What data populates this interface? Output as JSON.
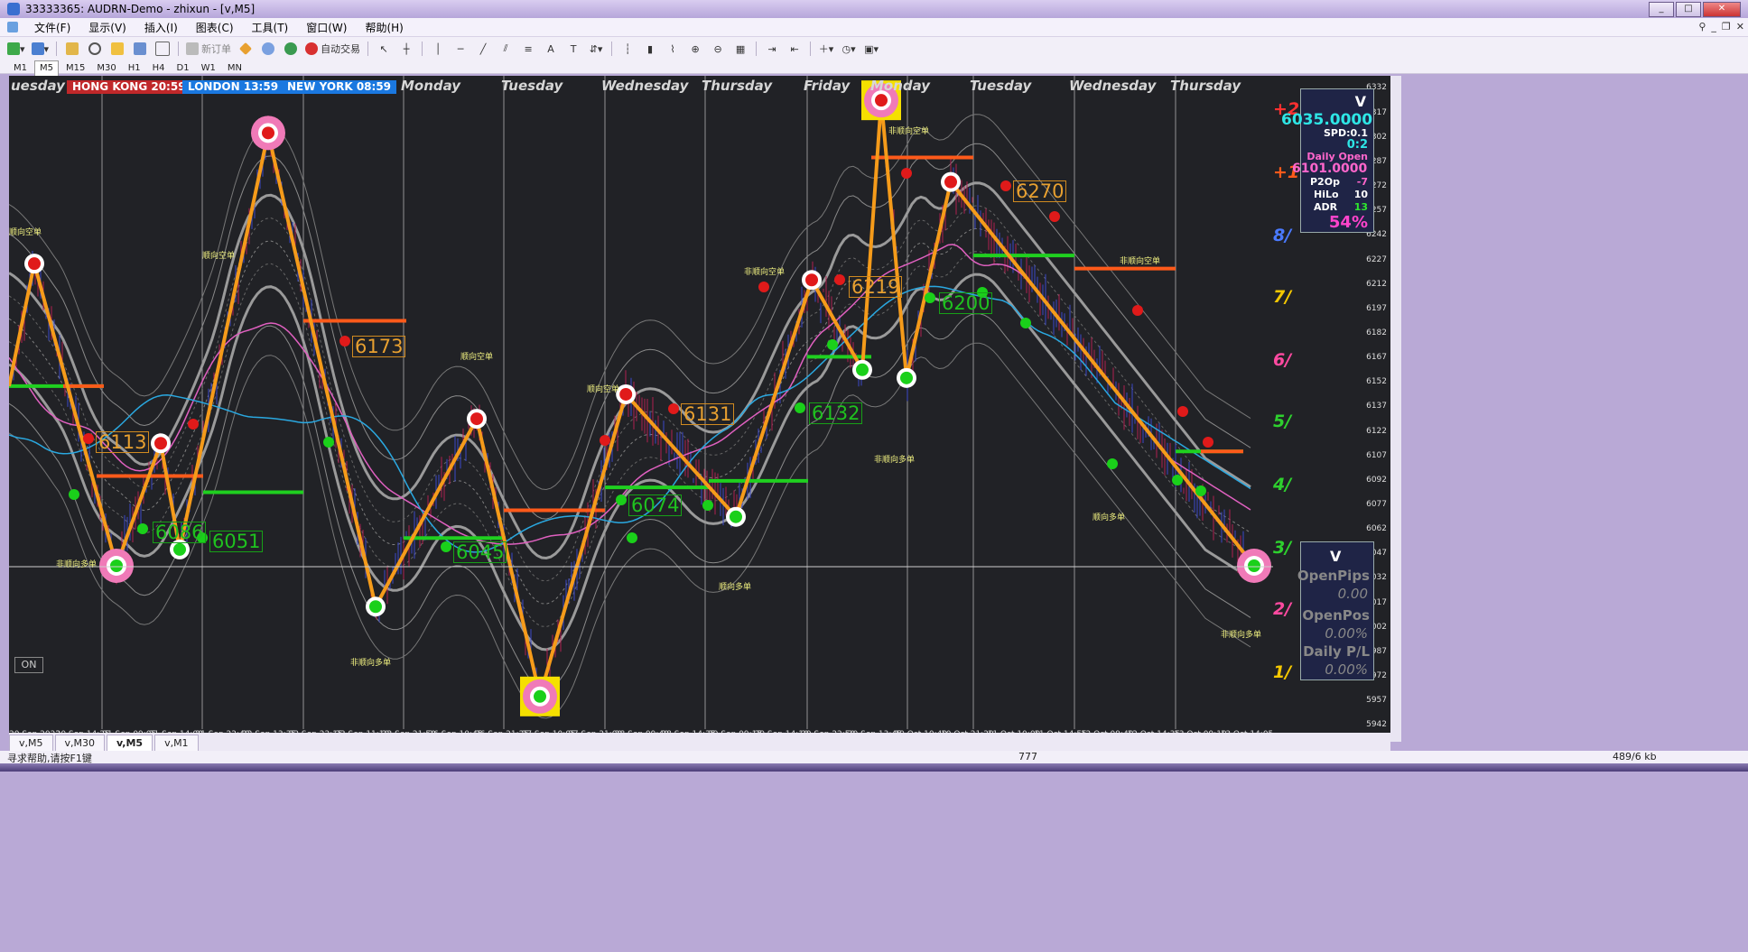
{
  "window": {
    "title": "33333365: AUDRN-Demo - zhixun - [v,M5]",
    "controls": [
      "_",
      "□",
      "✕"
    ]
  },
  "menu": {
    "items": [
      "文件(F)",
      "显示(V)",
      "插入(I)",
      "图表(C)",
      "工具(T)",
      "窗口(W)",
      "帮助(H)"
    ]
  },
  "toolbar": {
    "new_order": "新订单",
    "auto_trade": "自动交易",
    "timeframes": [
      "M1",
      "M5",
      "M15",
      "M30",
      "H1",
      "H4",
      "D1",
      "W1",
      "MN"
    ]
  },
  "chart": {
    "days": [
      "uesday",
      "Monday",
      "Tuesday",
      "Wednesday",
      "Thursday",
      "Friday",
      "Monday",
      "Tuesday",
      "Wednesday",
      "Thursday"
    ],
    "sessions": [
      {
        "label": "HONG KONG 20:59",
        "color": "#c0282a"
      },
      {
        "label": "LONDON  13:59",
        "color": "#1a78e0"
      },
      {
        "label": "NEW YORK 08:59",
        "color": "#1a78e0"
      }
    ],
    "price_boxes": [
      "6113",
      "6173",
      "6131",
      "6219",
      "6270",
      "6086",
      "6051",
      "6045",
      "6074",
      "6132",
      "6200"
    ],
    "cn_labels": [
      "顺向空单",
      "顺向空单",
      "顺向空单",
      "顺向空单",
      "非顺向空单",
      "非顺向空单",
      "非顺向多单",
      "非顺向多单",
      "非顺向多单",
      "顺向多单",
      "顺向多单",
      "非顺向多单",
      "非顺向空单"
    ],
    "on_button": "ON"
  },
  "chart_data": {
    "type": "line",
    "title": "",
    "xlabel": "",
    "ylabel": "",
    "x": [
      "20 Sep 2022",
      "20 Sep 14:25",
      "21 Sep 09:05",
      "21 Sep 14:00",
      "21 Sep 22:40",
      "22 Sep 13:35",
      "22 Sep 22:15",
      "23 Sep 11:10",
      "23 Sep 21:50",
      "26 Sep 10:45",
      "26 Sep 21:25",
      "27 Sep 10:05",
      "27 Sep 21:00",
      "28 Sep 09:40",
      "28 Sep 14:35",
      "29 Sep 09:15",
      "29 Sep 14:10",
      "29 Sep 22:50",
      "30 Sep 13:45",
      "10 Oct 10:40",
      "10 Oct 21:20",
      "11 Oct 10:00",
      "11 Oct 14:55",
      "12 Oct 09:40",
      "12 Oct 14:35",
      "13 Oct 09:10",
      "13 Oct 14:05"
    ],
    "ylim": [
      5940,
      6340
    ],
    "y_ticks": [
      "6332",
      "6317",
      "6302",
      "6287",
      "6272",
      "6257",
      "6242",
      "6227",
      "6212",
      "6197",
      "6182",
      "6167",
      "6152",
      "6137",
      "6122",
      "6107",
      "6092",
      "6077",
      "6062",
      "6047",
      "6032",
      "6017",
      "6002",
      "5987",
      "5972",
      "5957",
      "5942"
    ],
    "zigzag": [
      {
        "x": 0.0,
        "y": 6150
      },
      {
        "x": 0.02,
        "y": 6225
      },
      {
        "x": 0.085,
        "y": 6040
      },
      {
        "x": 0.12,
        "y": 6115
      },
      {
        "x": 0.135,
        "y": 6050
      },
      {
        "x": 0.205,
        "y": 6305
      },
      {
        "x": 0.29,
        "y": 6015
      },
      {
        "x": 0.37,
        "y": 6130
      },
      {
        "x": 0.42,
        "y": 5960
      },
      {
        "x": 0.488,
        "y": 6145
      },
      {
        "x": 0.575,
        "y": 6070
      },
      {
        "x": 0.635,
        "y": 6215
      },
      {
        "x": 0.675,
        "y": 6160
      },
      {
        "x": 0.69,
        "y": 6325
      },
      {
        "x": 0.71,
        "y": 6155
      },
      {
        "x": 0.745,
        "y": 6275
      },
      {
        "x": 0.985,
        "y": 6040
      }
    ],
    "pct_levels": [
      "+2",
      "+1",
      "8/",
      "7/",
      "6/",
      "5/",
      "4/",
      "3/",
      "2/",
      "1/"
    ]
  },
  "panel_top": {
    "v": "V",
    "price": "6035.0000",
    "spd": "SPD:0.1",
    "ratio": "0:2",
    "daily_open_label": "Daily Open",
    "daily_open": "6101.0000",
    "p2op_label": "P2Op",
    "p2op": "-7",
    "hilo_label": "HiLo",
    "hilo": "10",
    "adr_label": "ADR",
    "adr": "13",
    "adr_pct": "54%"
  },
  "panel_bottom": {
    "v": "V",
    "open_pips_label": "OpenPips",
    "open_pips": "0.00",
    "open_pos_label": "OpenPos",
    "open_pos": "0.00%",
    "daily_pl_label": "Daily P/L",
    "daily_pl": "0.00%"
  },
  "tabs": [
    "v,M5",
    "v,M30",
    "v,M5",
    "v,M1"
  ],
  "status": {
    "help": "寻求帮助,请按F1键",
    "center": "777",
    "traffic": "489/6 kb"
  },
  "colors": {
    "zigzag": "#f59b1a",
    "chart_bg": "#212226",
    "bands": "#8f8f8f"
  }
}
